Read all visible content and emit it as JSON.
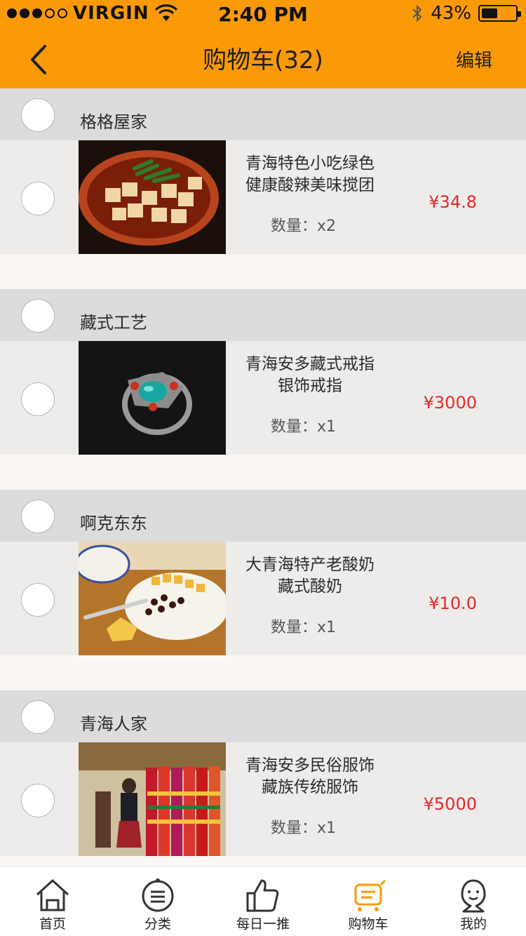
{
  "status_bar": {
    "carrier": "VIRGIN",
    "time": "2:40 PM",
    "battery": "43%",
    "signal_bars_filled": 3,
    "signal_bars_total": 5
  },
  "nav": {
    "title": "购物车(32)",
    "edit_label": "编辑",
    "back_icon": "chevron-left-icon"
  },
  "colors": {
    "accent": "#fa9a09",
    "price": "#e12a2a",
    "shop_row": "#dcdcdc",
    "item_row": "#eeeceb"
  },
  "cart": [
    {
      "shop": "格格屋家",
      "title_lines": [
        "青海特色小吃绿色",
        "健康酸辣美味搅团"
      ],
      "qty_label": "数量：",
      "qty": "x2",
      "price": "¥34.8",
      "image": "tofu-dish"
    },
    {
      "shop": "藏式工艺",
      "title_lines": [
        "青海安多藏式戒指",
        "银饰戒指"
      ],
      "qty_label": "数量：",
      "qty": "x1",
      "price": "¥3000",
      "image": "turquoise-ring"
    },
    {
      "shop": "啊克东东",
      "title_lines": [
        "大青海特产老酸奶",
        "藏式酸奶"
      ],
      "qty_label": "数量：",
      "qty": "x1",
      "price": "¥10.0",
      "image": "yogurt-bowl"
    },
    {
      "shop": "青海人家",
      "title_lines": [
        "青海安多民俗服饰",
        "藏族传统服饰"
      ],
      "qty_label": "数量：",
      "qty": "x1",
      "price": "¥5000",
      "image": "tibetan-costumes"
    }
  ],
  "tabs": [
    {
      "label": "首页",
      "icon": "home-icon",
      "active": false
    },
    {
      "label": "分类",
      "icon": "category-icon",
      "active": false
    },
    {
      "label": "每日一推",
      "icon": "thumbs-up-icon",
      "active": false
    },
    {
      "label": "购物车",
      "icon": "cart-icon",
      "active": true
    },
    {
      "label": "我的",
      "icon": "profile-icon",
      "active": false
    }
  ]
}
